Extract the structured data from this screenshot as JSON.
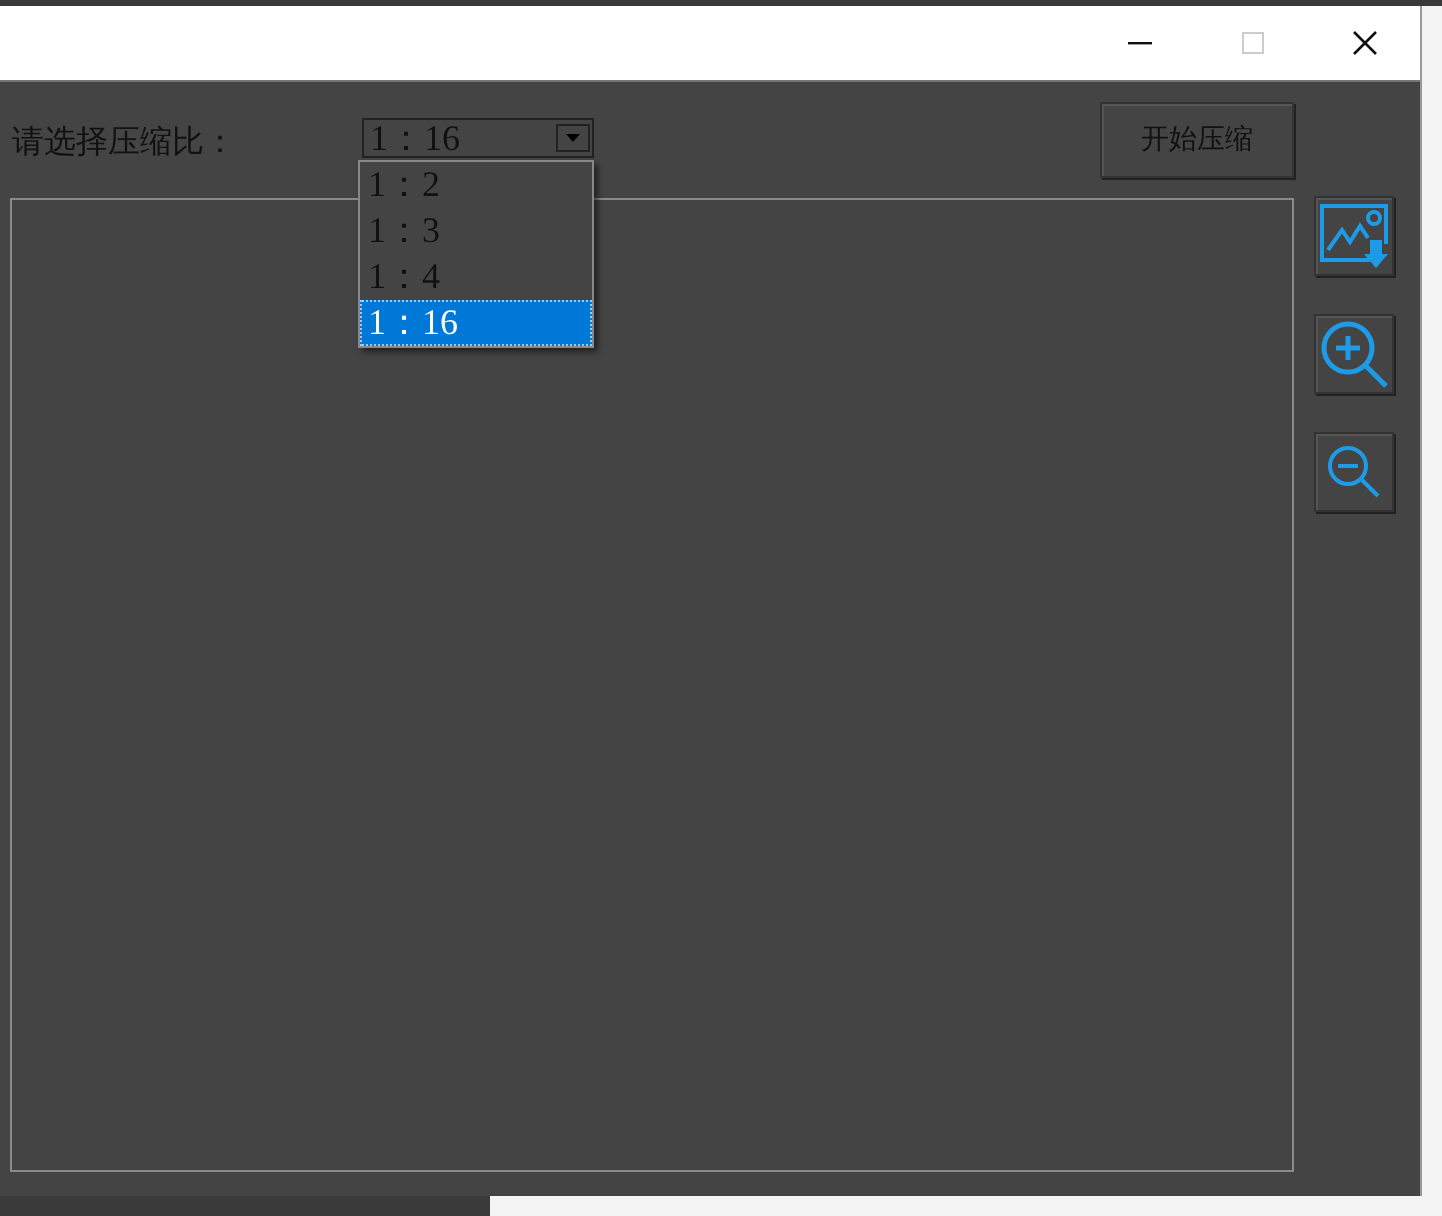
{
  "prompt_label": "请选择压缩比：",
  "ratio_select": {
    "value": "1：16",
    "expanded": true,
    "options": [
      {
        "label": "1：2",
        "selected": false
      },
      {
        "label": "1：3",
        "selected": false
      },
      {
        "label": "1：4",
        "selected": false
      },
      {
        "label": "1：16",
        "selected": true
      }
    ]
  },
  "start_button": "开始压缩"
}
